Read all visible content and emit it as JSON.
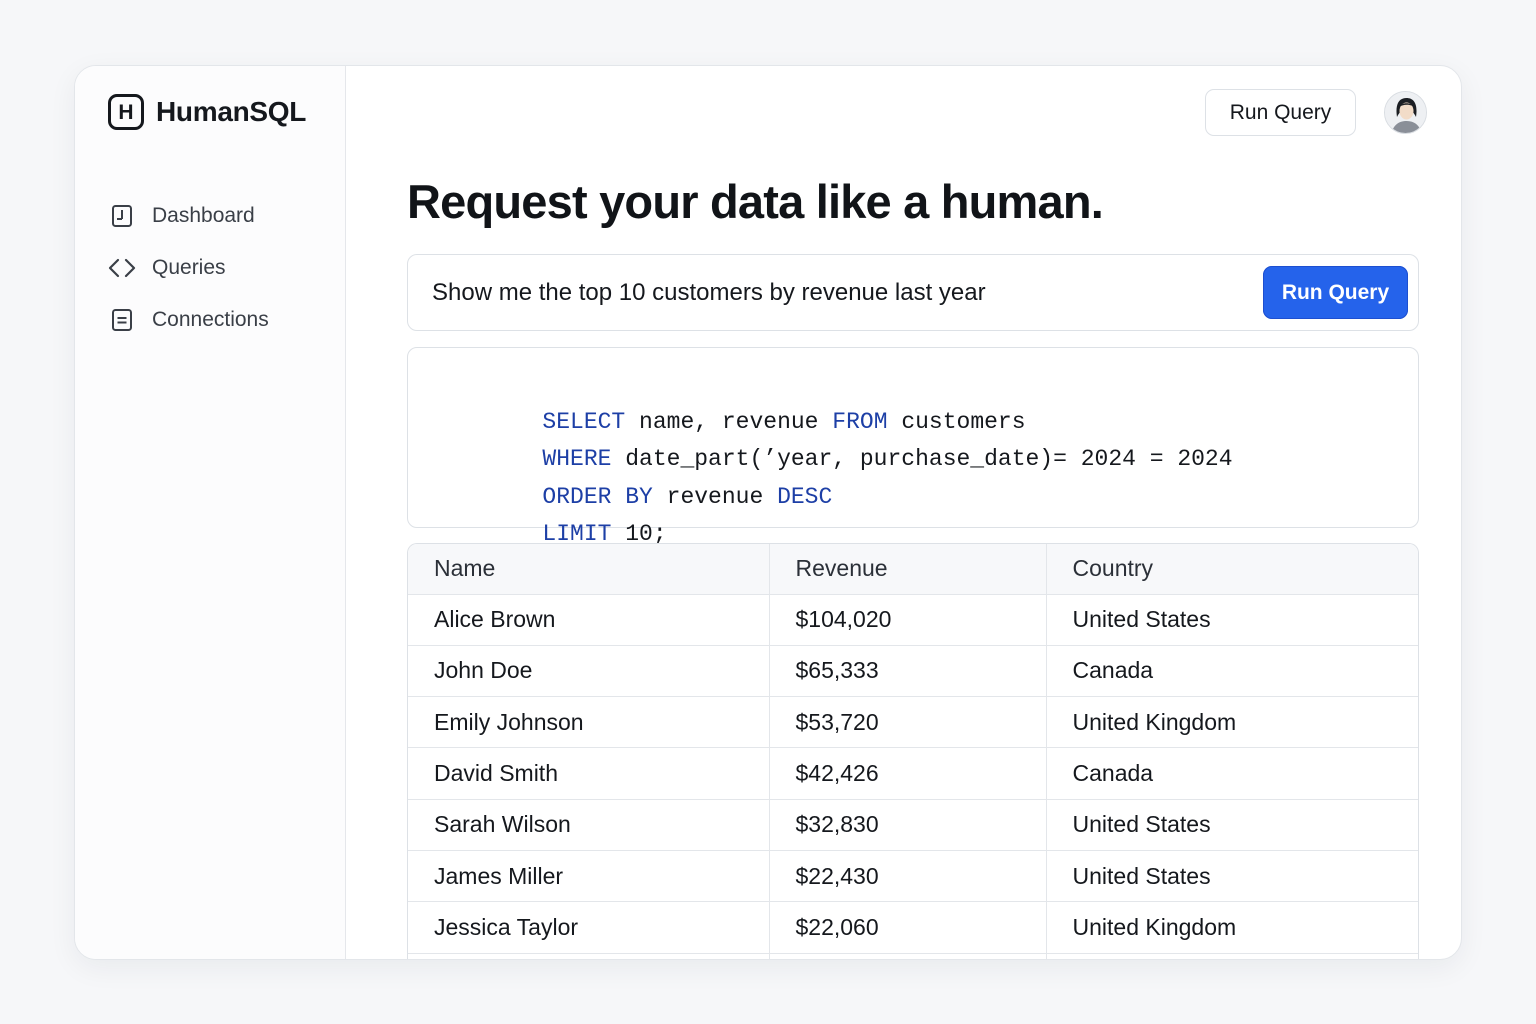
{
  "app": {
    "name": "HumanSQL",
    "logo_letter": "H"
  },
  "sidebar": {
    "items": [
      {
        "label": "Dashboard",
        "icon": "dashboard-icon"
      },
      {
        "label": "Queries",
        "icon": "code-icon"
      },
      {
        "label": "Connections",
        "icon": "document-icon"
      }
    ]
  },
  "header": {
    "run_label": "Run Query",
    "avatar": "user-avatar"
  },
  "main": {
    "title": "Request your data like a human.",
    "query": {
      "value": "Show me the top 10 customers by revenue last year",
      "run_label": "Run Query"
    },
    "sql": {
      "lines": [
        [
          {
            "t": "SELECT",
            "kw": true
          },
          {
            "t": " name, revenue "
          },
          {
            "t": "FROM",
            "kw": true
          },
          {
            "t": " customers"
          }
        ],
        [
          {
            "t": "WHERE",
            "kw": true
          },
          {
            "t": " date_part(’year, purchase_date)= 2024 = 2024"
          }
        ],
        [
          {
            "t": "ORDER BY",
            "kw": true
          },
          {
            "t": " revenue "
          },
          {
            "t": "DESC",
            "kw": true
          }
        ],
        [
          {
            "t": "LIMIT",
            "kw": true
          },
          {
            "t": " 10;"
          }
        ]
      ]
    },
    "results": {
      "columns": [
        "Name",
        "Revenue",
        "Country"
      ],
      "rows": [
        [
          "Alice Brown",
          "$104,020",
          "United States"
        ],
        [
          "John Doe",
          "$65,333",
          "Canada"
        ],
        [
          "Emily Johnson",
          "$53,720",
          "United Kingdom"
        ],
        [
          "David Smith",
          "$42,426",
          "Canada"
        ],
        [
          "Sarah Wilson",
          "$32,830",
          "United States"
        ],
        [
          "James Miller",
          "$22,430",
          "United States"
        ],
        [
          "Jessica Taylor",
          "$22,060",
          "United Kingdom"
        ]
      ]
    }
  },
  "colors": {
    "accent": "#2563eb",
    "sql_keyword": "#1d3fa6",
    "border": "#dde1e6",
    "text": "#15181d"
  }
}
